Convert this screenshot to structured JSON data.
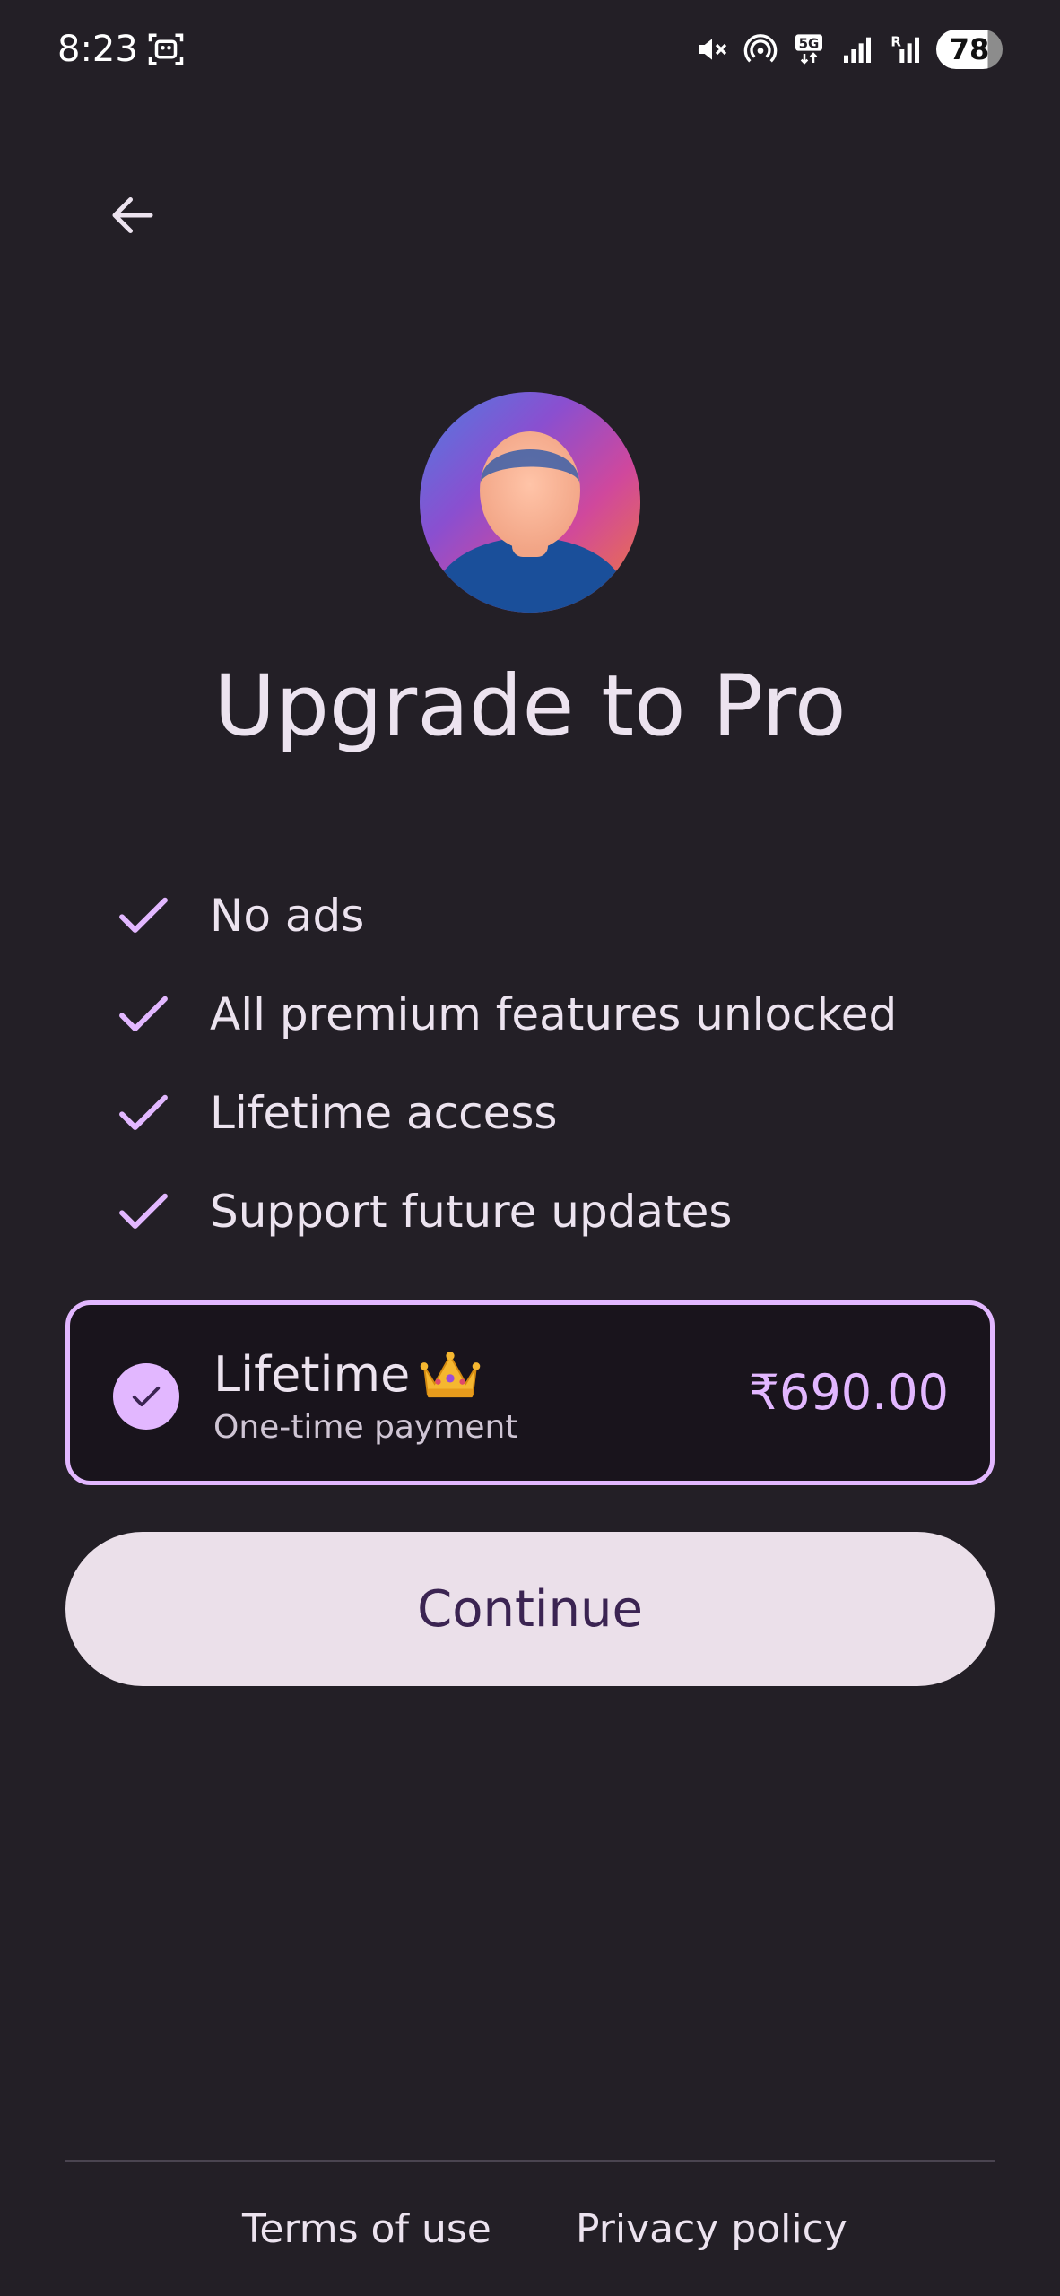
{
  "status_bar": {
    "time": "8:23",
    "battery": "78",
    "icons": [
      "screen-record-icon",
      "mute-icon",
      "hotspot-icon",
      "5g-icon",
      "signal-icon",
      "signal-roaming-icon"
    ]
  },
  "header": {
    "back_icon": "arrow-left-icon"
  },
  "title": "Upgrade to Pro",
  "features": [
    "No ads",
    "All premium features unlocked",
    "Lifetime access",
    "Support future updates"
  ],
  "plan": {
    "name": "Lifetime",
    "subtitle": "One-time payment",
    "price": "₹690.00",
    "selected": true,
    "emoji": "crown-emoji"
  },
  "continue_label": "Continue",
  "footer": {
    "terms": "Terms of use",
    "privacy": "Privacy policy"
  },
  "colors": {
    "background": "#231f26",
    "accent": "#e2b7ff",
    "button_bg": "#ebe0ea",
    "button_text": "#3b2452"
  }
}
